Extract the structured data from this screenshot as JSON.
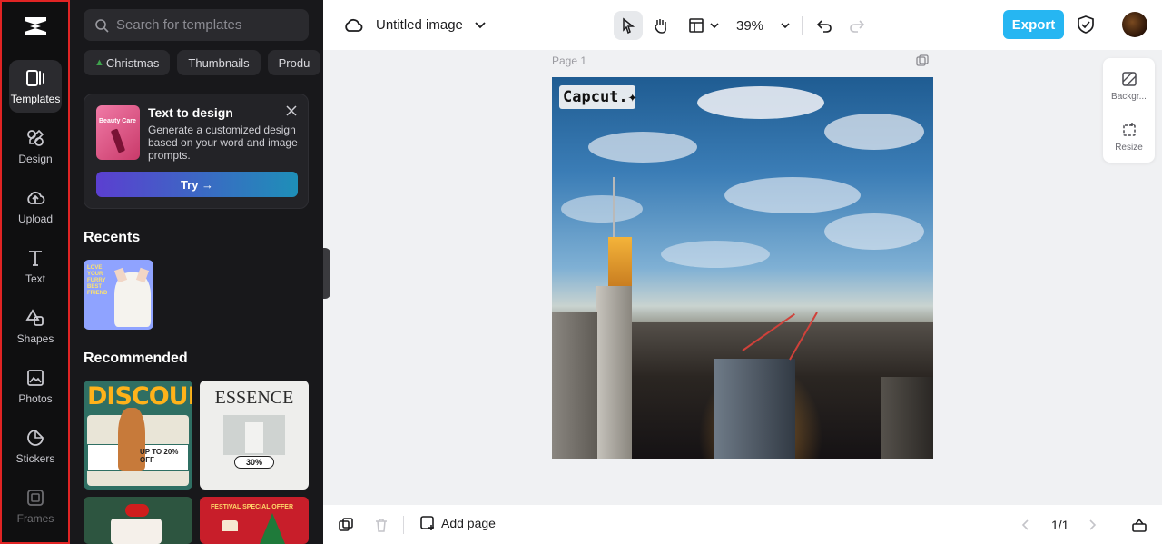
{
  "rail": {
    "items": [
      {
        "label": "Templates",
        "icon": "templates-icon"
      },
      {
        "label": "Design",
        "icon": "design-icon"
      },
      {
        "label": "Upload",
        "icon": "upload-icon"
      },
      {
        "label": "Text",
        "icon": "text-icon"
      },
      {
        "label": "Shapes",
        "icon": "shapes-icon"
      },
      {
        "label": "Photos",
        "icon": "photos-icon"
      },
      {
        "label": "Stickers",
        "icon": "stickers-icon"
      },
      {
        "label": "Frames",
        "icon": "frames-icon"
      }
    ]
  },
  "panel": {
    "search_placeholder": "Search for templates",
    "chips": [
      "Christmas",
      "Thumbnails",
      "Produ"
    ],
    "promo": {
      "title": "Text to design",
      "desc": "Generate a customized design based on your word and image prompts.",
      "thumb_text": "Beauty Care",
      "button": "Try →"
    },
    "recents_title": "Recents",
    "recent_thumb_text": "LOVE YOUR FURRY BEST FRIEND",
    "recommended_title": "Recommended",
    "templates": {
      "discount_text": "DISCOUNT",
      "discount_offer": "UP TO 20% OFF",
      "essence_text": "ESSENCE",
      "essence_pct": "30%",
      "xmas2_text": "FESTIVAL SPECIAL OFFER"
    }
  },
  "topbar": {
    "doc_title": "Untitled image",
    "zoom": "39%",
    "export_label": "Export"
  },
  "canvas": {
    "page_label": "Page 1",
    "badge_text": "Capcut.✦"
  },
  "right_panel": {
    "background_label": "Backgr...",
    "resize_label": "Resize"
  },
  "bottombar": {
    "add_page_label": "Add page",
    "page_indicator": "1/1"
  },
  "colors": {
    "accent": "#26b6f2",
    "rail_bg": "#0f0f10",
    "panel_bg": "#18181b",
    "highlight_border": "#e02424"
  }
}
